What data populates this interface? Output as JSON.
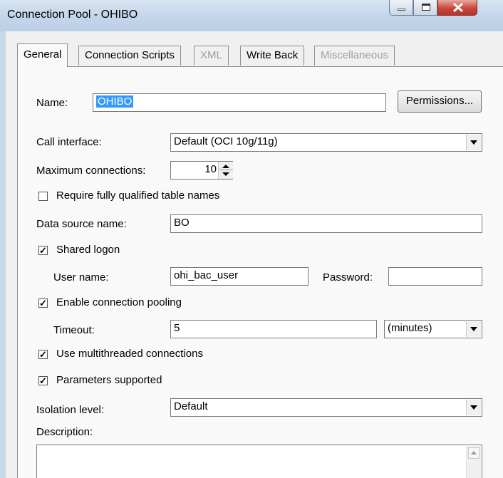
{
  "window": {
    "title": "Connection Pool - OHIBO"
  },
  "tabs": [
    {
      "label": "General",
      "active": true,
      "disabled": false
    },
    {
      "label": "Connection Scripts",
      "active": false,
      "disabled": false
    },
    {
      "label": "XML",
      "active": false,
      "disabled": true
    },
    {
      "label": "Write Back",
      "active": false,
      "disabled": false
    },
    {
      "label": "Miscellaneous",
      "active": false,
      "disabled": true
    }
  ],
  "general": {
    "name_label": "Name:",
    "name_value": "OHIBO",
    "permissions_button": "Permissions...",
    "call_interface_label": "Call interface:",
    "call_interface_value": "Default (OCI 10g/11g)",
    "max_connections_label": "Maximum connections:",
    "max_connections_value": "10",
    "require_qualified_label": "Require fully qualified table names",
    "require_qualified_checked": false,
    "data_source_label": "Data source name:",
    "data_source_value": "BO",
    "shared_logon_label": "Shared logon",
    "shared_logon_checked": true,
    "user_name_label": "User name:",
    "user_name_value": "ohi_bac_user",
    "password_label": "Password:",
    "password_value": "",
    "enable_pooling_label": "Enable connection pooling",
    "enable_pooling_checked": true,
    "timeout_label": "Timeout:",
    "timeout_value": "5",
    "timeout_unit": "(minutes)",
    "multithreaded_label": "Use multithreaded connections",
    "multithreaded_checked": true,
    "parameters_label": "Parameters supported",
    "parameters_checked": true,
    "isolation_label": "Isolation level:",
    "isolation_value": "Default",
    "description_label": "Description:",
    "description_value": ""
  },
  "check_glyph": "✓"
}
